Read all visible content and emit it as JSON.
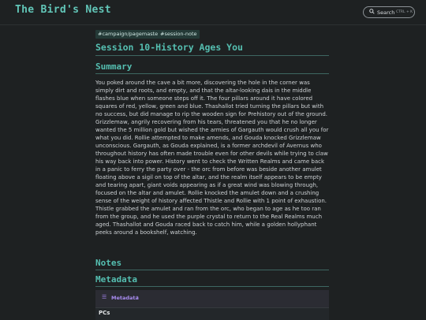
{
  "header": {
    "site_title": "The Bird's Nest",
    "search_label": "Search",
    "search_shortcut": "CTRL + K"
  },
  "tags": [
    "#campaign/pagemaster",
    "#session-note"
  ],
  "page_title": "Session 10-History Ages You",
  "sections": {
    "summary": "Summary",
    "notes": "Notes",
    "metadata": "Metadata"
  },
  "summary_text": "You poked around the cave a bit more, discovering the hole in the corner was simply dirt and roots, and empty, and that the altar-looking dais in the middle flashes blue when someone steps off it. The four pillars around it have colored squares of red, yellow, green and blue. Thashallot tried turning the pillars but with no success, but did manage to rip the wooden sign for Prehistory out of the ground. Grizzlemaw, angrily recovering from his tears, threatened you that he no longer wanted the 5 million gold but wished the armies of Gargauth would crush all you for what you did. Rollie attempted to make amends, and Gouda knocked Grizzlemaw unconscious. Gargauth, as Gouda explained, is a former archdevil of Avernus who throughout history has often made trouble even for other devils while trying to claw his way back into power. History went to check the Written Realms and came back in a panic to ferry the party over - the orc from before was beside another amulet floating above a sigil on top of the altar, and the realm itself appears to be empty and tearing apart, giant voids appearing as if a great wind was blowing through, focused on the altar and amulet. Rollie knocked the amulet down and a crushing sense of the weight of history affected Thistle and Rollie with 1 point of exhaustion. Thistle grabbed the amulet and ran from the orc, who began to age as he too ran from the group, and he used the purple crystal to return to the Real Realms much aged. Thashallot and Gouda raced back to catch him, while a golden hollyphant peeks around a bookshelf, watching.",
  "metadata_callout": {
    "icon": "list-icon",
    "label": "Metadata",
    "chevron": "›"
  },
  "metadata_rows": [
    {
      "label": "PCs"
    }
  ],
  "colors": {
    "accent": "#55bfb1",
    "background": "#1e2122",
    "tag_bg": "#243a37",
    "callout_purple": "#a88cf0"
  }
}
